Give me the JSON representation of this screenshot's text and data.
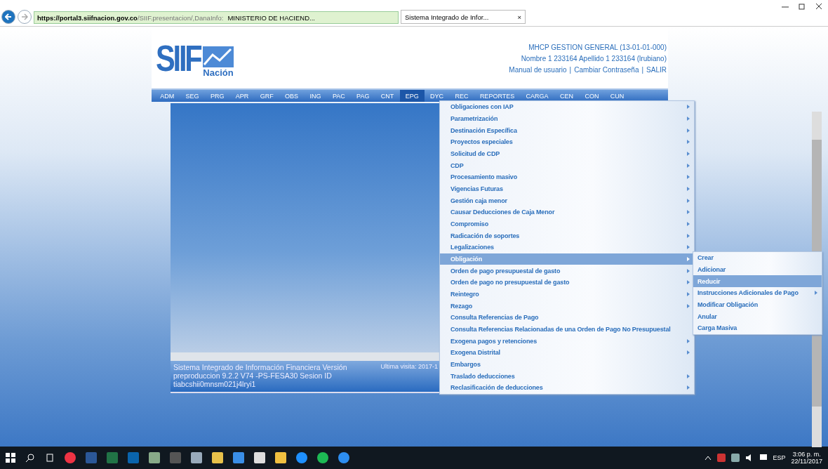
{
  "browser": {
    "url_host": "https://portal3.siifnacion.gov.co",
    "url_path": "/SIIF.presentacion/,DanaInfo:",
    "site_name": "MINISTERIO DE HACIEND...",
    "tab_title": "Sistema Integrado de Infor...",
    "tab_close": "×"
  },
  "logo": {
    "text": "SIIF",
    "subtitle": "Nación"
  },
  "header": {
    "entity": "MHCP GESTION GENERAL (13-01-01-000)",
    "user": "Nombre 1 233164 Apellido 1 233164 (lrubiano)",
    "links": [
      "Manual de usuario",
      "Cambiar Contraseña",
      "SALIR"
    ],
    "separator": "|"
  },
  "nav": [
    {
      "label": "ADM",
      "selected": false
    },
    {
      "label": "SEG",
      "selected": false
    },
    {
      "label": "PRG",
      "selected": false
    },
    {
      "label": "APR",
      "selected": false
    },
    {
      "label": "GRF",
      "selected": false
    },
    {
      "label": "OBS",
      "selected": false
    },
    {
      "label": "ING",
      "selected": false
    },
    {
      "label": "PAC",
      "selected": false
    },
    {
      "label": "PAG",
      "selected": false
    },
    {
      "label": "CNT",
      "selected": false
    },
    {
      "label": "EPG",
      "selected": true
    },
    {
      "label": "DYC",
      "selected": false
    },
    {
      "label": "REC",
      "selected": false
    },
    {
      "label": "REPORTES",
      "selected": false
    },
    {
      "label": "CARGA",
      "selected": false
    },
    {
      "label": "CEN",
      "selected": false
    },
    {
      "label": "CON",
      "selected": false
    },
    {
      "label": "CUN",
      "selected": false
    }
  ],
  "footer": {
    "info": "Sistema Integrado de Información Financiera Versión preproduccion 9.2.2 V74 -PS-FESA30 Sesion ID tiabcshii0mnsm021j4lryi1",
    "last_visit": "Ultima visita: 2017-1"
  },
  "menu": [
    {
      "label": "Obligaciones con IAP",
      "submenu": true,
      "selected": false
    },
    {
      "label": "Parametrización",
      "submenu": true,
      "selected": false
    },
    {
      "label": "Destinación Específica",
      "submenu": true,
      "selected": false
    },
    {
      "label": "Proyectos especiales",
      "submenu": true,
      "selected": false
    },
    {
      "label": "Solicitud de CDP",
      "submenu": true,
      "selected": false
    },
    {
      "label": "CDP",
      "submenu": true,
      "selected": false
    },
    {
      "label": "Procesamiento masivo",
      "submenu": true,
      "selected": false
    },
    {
      "label": "Vigencias Futuras",
      "submenu": true,
      "selected": false
    },
    {
      "label": "Gestión caja menor",
      "submenu": true,
      "selected": false
    },
    {
      "label": "Causar Deducciones de Caja Menor",
      "submenu": true,
      "selected": false
    },
    {
      "label": "Compromiso",
      "submenu": true,
      "selected": false
    },
    {
      "label": "Radicación de soportes",
      "submenu": true,
      "selected": false
    },
    {
      "label": "Legalizaciones",
      "submenu": true,
      "selected": false
    },
    {
      "label": "Obligación",
      "submenu": true,
      "selected": true
    },
    {
      "label": "Orden de pago presupuestal de gasto",
      "submenu": true,
      "selected": false
    },
    {
      "label": "Orden de pago no presupuestal de gasto",
      "submenu": true,
      "selected": false
    },
    {
      "label": "Reintegro",
      "submenu": true,
      "selected": false
    },
    {
      "label": "Rezago",
      "submenu": true,
      "selected": false
    },
    {
      "label": "Consulta Referencias de Pago",
      "submenu": false,
      "selected": false
    },
    {
      "label": "Consulta Referencias Relacionadas de una Orden de Pago No Presupuestal",
      "submenu": false,
      "selected": false
    },
    {
      "label": "Exogena pagos y retenciones",
      "submenu": true,
      "selected": false
    },
    {
      "label": "Exogena Distrital",
      "submenu": true,
      "selected": false
    },
    {
      "label": "Embargos",
      "submenu": false,
      "selected": false
    },
    {
      "label": "Traslado deducciones",
      "submenu": true,
      "selected": false
    },
    {
      "label": "Reclasificación de deducciones",
      "submenu": true,
      "selected": false
    }
  ],
  "submenu": [
    {
      "label": "Crear",
      "submenu": false,
      "selected": false
    },
    {
      "label": "Adicionar",
      "submenu": false,
      "selected": false
    },
    {
      "label": "Reducir",
      "submenu": false,
      "selected": true
    },
    {
      "label": "Instrucciones Adicionales de Pago",
      "submenu": true,
      "selected": false
    },
    {
      "label": "Modificar Obligación",
      "submenu": false,
      "selected": false
    },
    {
      "label": "Anular",
      "submenu": false,
      "selected": false
    },
    {
      "label": "Carga Masiva",
      "submenu": false,
      "selected": false
    }
  ],
  "taskbar": {
    "language": "ESP",
    "time": "3:06 p. m.",
    "date": "22/11/2017"
  }
}
